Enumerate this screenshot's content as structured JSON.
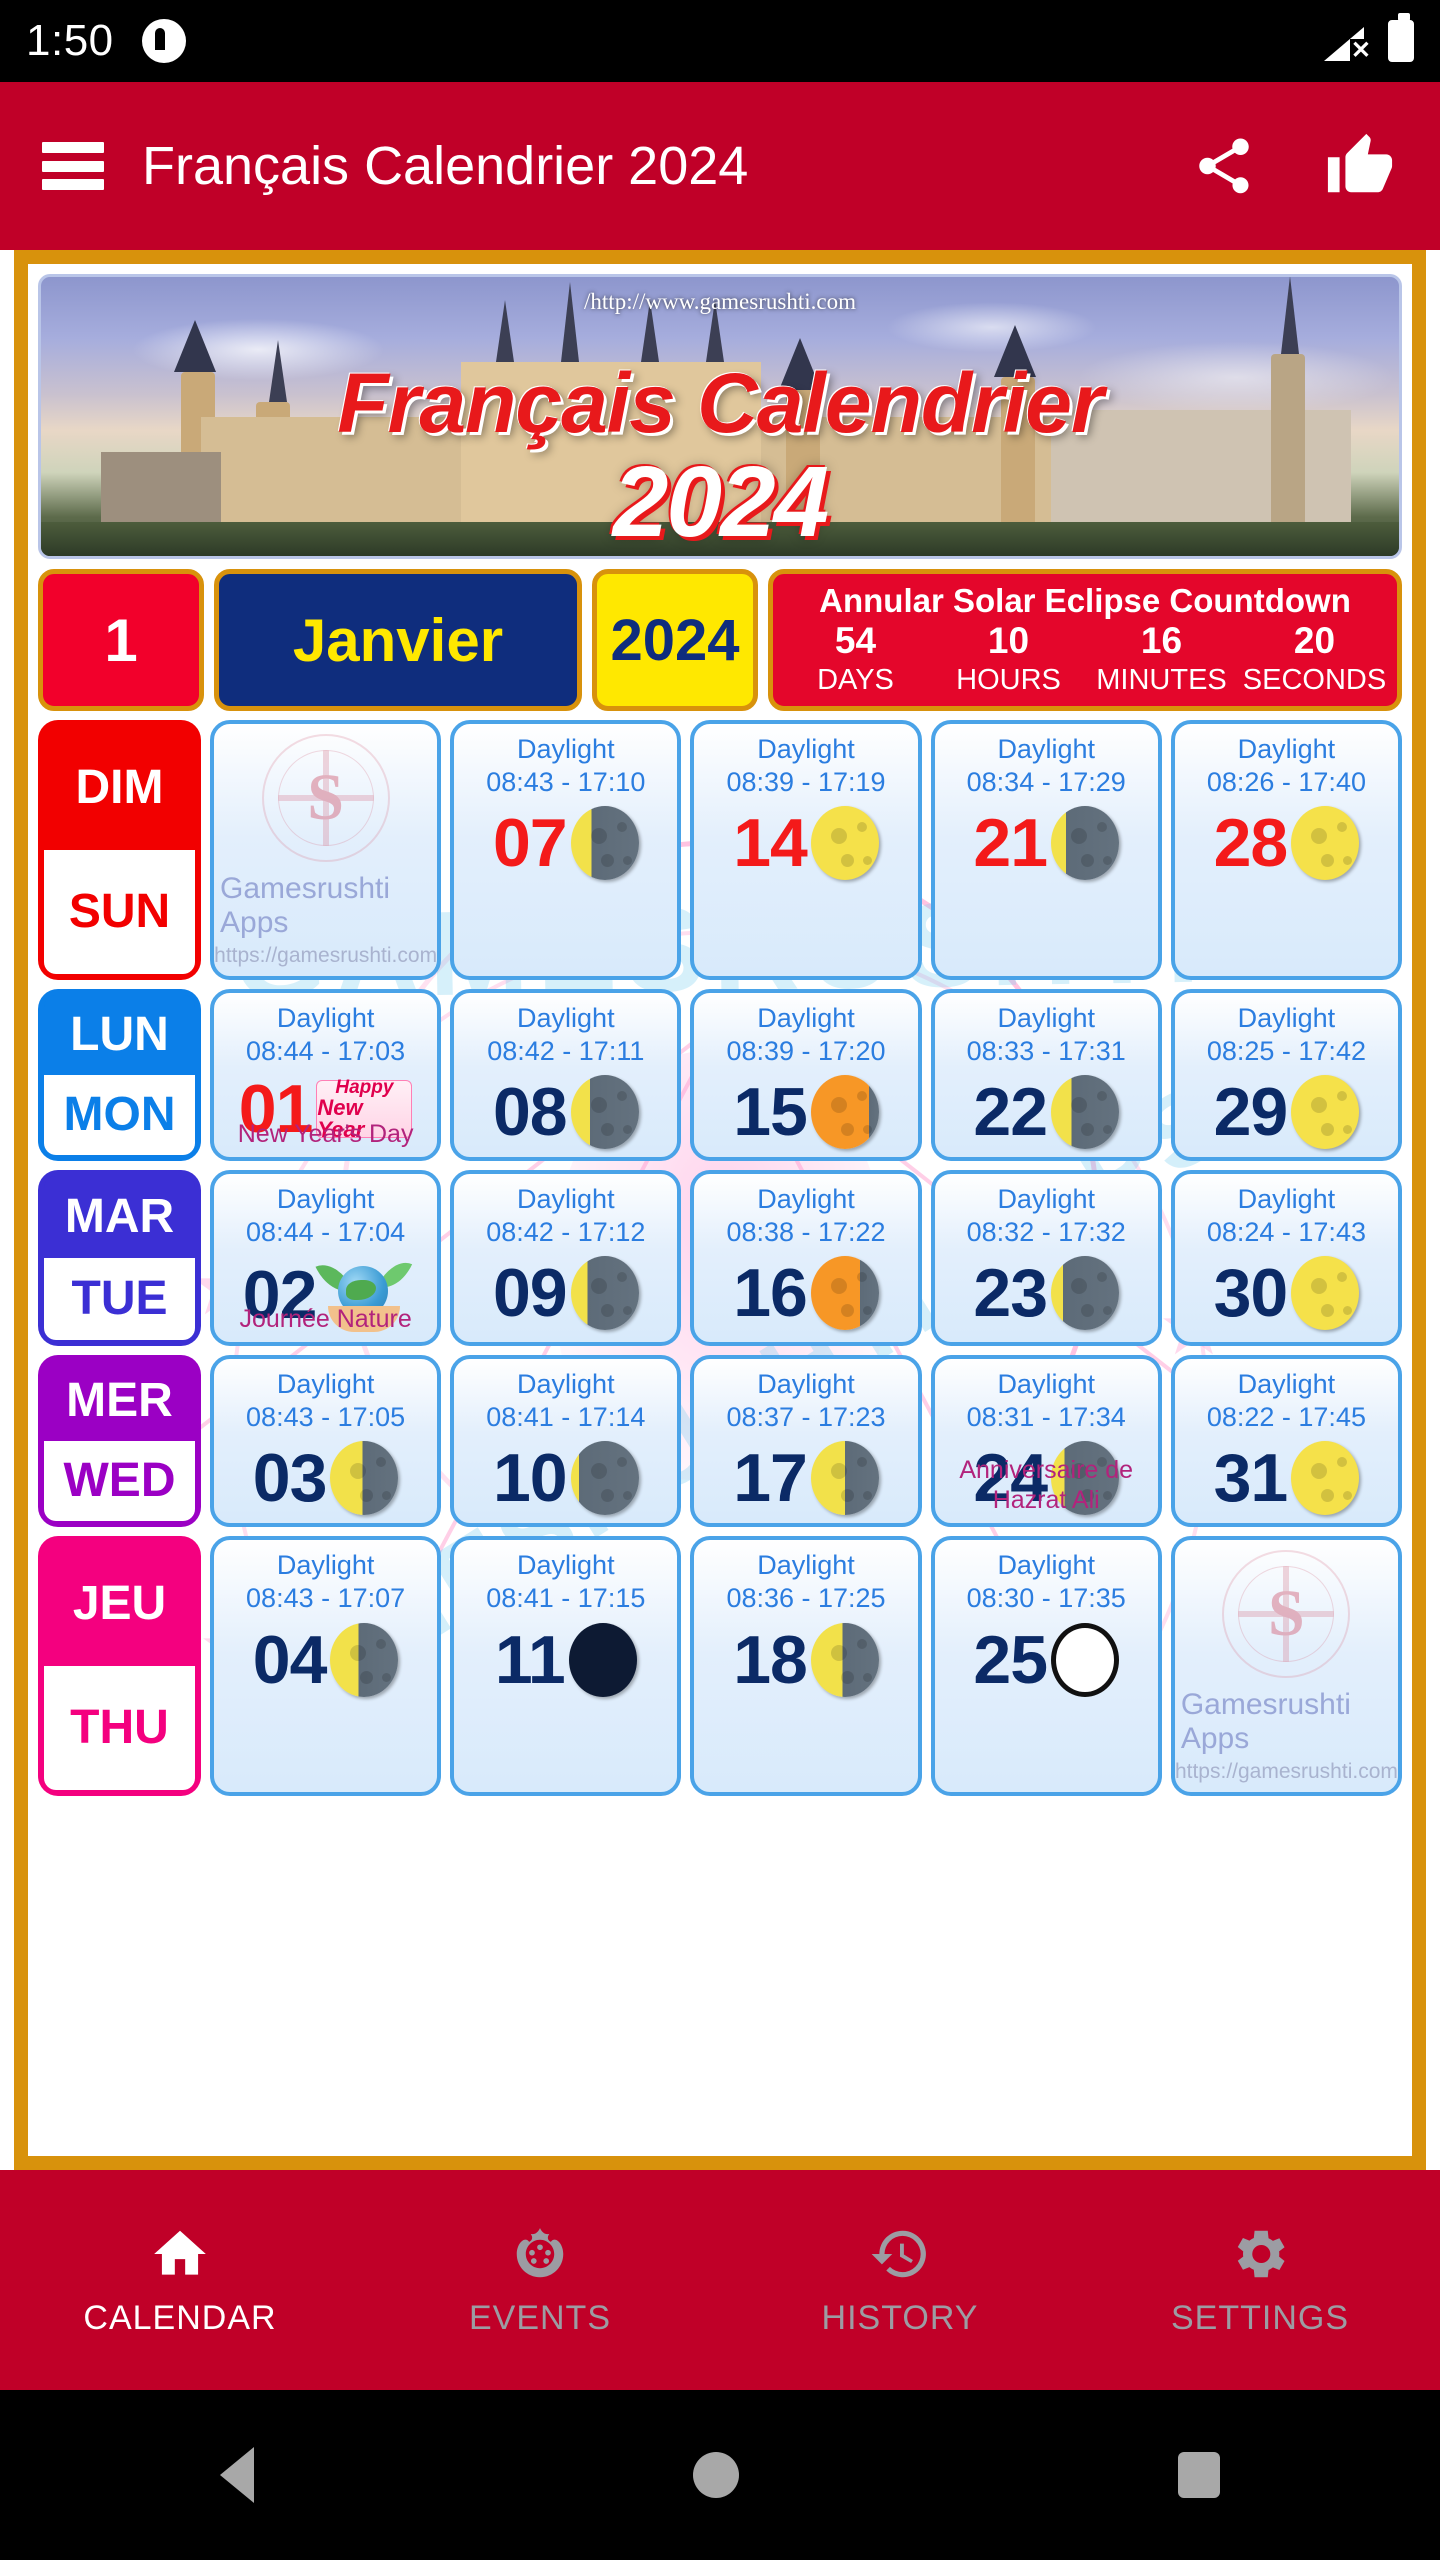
{
  "statusbar": {
    "time": "1:50",
    "signal_icon": "no-signal-icon",
    "battery_icon": "battery-full-icon"
  },
  "appbar": {
    "title": "Français Calendrier 2024",
    "menu_icon": "hamburger-menu-icon",
    "share_icon": "share-icon",
    "like_icon": "thumbs-up-icon"
  },
  "banner": {
    "url": "/http://www.gamesrushti.com",
    "title": "Français Calendrier",
    "year": "2024"
  },
  "selector": {
    "day": "1",
    "month": "Janvier",
    "year": "2024"
  },
  "countdown": {
    "title": "Annular Solar Eclipse Countdown",
    "values": [
      "54",
      "10",
      "16",
      "20"
    ],
    "labels": [
      "DAYS",
      "HOURS",
      "MINUTES",
      "SECONDS"
    ]
  },
  "branding": {
    "name": "Gamesrushti Apps",
    "url": "https://gamesrushti.com",
    "logo_icon": "gamesrushti-logo-icon"
  },
  "watermark": {
    "text1": "GAMESRUSHTI",
    "text2": "GAMESRUSHTI APPS"
  },
  "daylight_label": "Daylight",
  "rows": [
    {
      "abbr": "DIM",
      "en": "SUN",
      "color": "#f20000",
      "text_color": "#f20000",
      "cells": [
        {
          "type": "brand"
        },
        {
          "day": "07",
          "red": true,
          "daylight": "08:43 - 17:10",
          "moon": "waning-gibbous",
          "lit": 0.3,
          "side": "left",
          "tint": "#f2e14a",
          "event": ""
        },
        {
          "day": "14",
          "red": true,
          "daylight": "08:39 - 17:19",
          "moon": "first-quarter-bright",
          "lit": 1.0,
          "side": "left",
          "tint": "#f5e14a",
          "event": ""
        },
        {
          "day": "21",
          "red": true,
          "daylight": "08:34 - 17:29",
          "moon": "waning-crescent",
          "lit": 0.22,
          "side": "left",
          "tint": "#f2e14a",
          "event": ""
        },
        {
          "day": "28",
          "red": true,
          "daylight": "08:26 - 17:40",
          "moon": "full-moon",
          "lit": 1.0,
          "side": "left",
          "tint": "#f5e14a",
          "event": ""
        }
      ]
    },
    {
      "abbr": "LUN",
      "en": "MON",
      "color": "#0b7fe8",
      "text_color": "#0b7fe8",
      "cells": [
        {
          "day": "01",
          "red": true,
          "daylight": "08:44 - 17:03",
          "moon": "new-year-badge",
          "badge": "newyear",
          "event": "New Year's Day"
        },
        {
          "day": "08",
          "red": false,
          "daylight": "08:42 - 17:11",
          "moon": "waning-gibbous",
          "lit": 0.28,
          "side": "left",
          "tint": "#f2e14a",
          "event": ""
        },
        {
          "day": "15",
          "red": false,
          "daylight": "08:39 - 17:20",
          "moon": "waxing-orange",
          "lit": 0.85,
          "side": "left",
          "tint": "#f79726",
          "event": ""
        },
        {
          "day": "22",
          "red": false,
          "daylight": "08:33 - 17:31",
          "moon": "waning-gibbous-green",
          "lit": 0.3,
          "side": "left",
          "tint": "#f2e14a",
          "event": ""
        },
        {
          "day": "29",
          "red": false,
          "daylight": "08:25 - 17:42",
          "moon": "full-moon",
          "lit": 1.0,
          "side": "left",
          "tint": "#f5e14a",
          "event": ""
        }
      ]
    },
    {
      "abbr": "MAR",
      "en": "TUE",
      "color": "#3b2fd4",
      "text_color": "#3b2fd4",
      "cells": [
        {
          "day": "02",
          "red": false,
          "daylight": "08:44 - 17:04",
          "moon": "nature-badge",
          "badge": "nature",
          "event": "Journée Nature"
        },
        {
          "day": "09",
          "red": false,
          "daylight": "08:42 - 17:12",
          "moon": "waning-crescent-red",
          "lit": 0.24,
          "side": "left",
          "tint": "#f2e14a",
          "event": ""
        },
        {
          "day": "16",
          "red": false,
          "daylight": "08:38 - 17:22",
          "moon": "waxing-orange",
          "lit": 0.72,
          "side": "left",
          "tint": "#f79726",
          "event": ""
        },
        {
          "day": "23",
          "red": false,
          "daylight": "08:32 - 17:32",
          "moon": "waning-crescent",
          "lit": 0.18,
          "side": "left",
          "tint": "#f2e14a",
          "event": ""
        },
        {
          "day": "30",
          "red": false,
          "daylight": "08:24 - 17:43",
          "moon": "full-moon",
          "lit": 1.0,
          "side": "left",
          "tint": "#f5e14a",
          "event": ""
        }
      ]
    },
    {
      "abbr": "MER",
      "en": "WED",
      "color": "#9b00c4",
      "text_color": "#9b00c4",
      "cells": [
        {
          "day": "03",
          "red": false,
          "daylight": "08:43 - 17:05",
          "moon": "last-quarter",
          "lit": 0.48,
          "side": "left",
          "tint": "#f2e14a",
          "event": ""
        },
        {
          "day": "10",
          "red": false,
          "daylight": "08:41 - 17:14",
          "moon": "waning-crescent",
          "lit": 0.12,
          "side": "left",
          "tint": "#f2e14a",
          "event": ""
        },
        {
          "day": "17",
          "red": false,
          "daylight": "08:37 - 17:23",
          "moon": "first-quarter",
          "lit": 0.5,
          "side": "left",
          "tint": "#f2e14a",
          "event": ""
        },
        {
          "day": "24",
          "red": false,
          "daylight": "08:31 - 17:34",
          "moon": "waning-gibbous-green",
          "lit": 0.2,
          "side": "left",
          "tint": "#f2e14a",
          "event": "Anniversaire de Hazrat Ali"
        },
        {
          "day": "31",
          "red": false,
          "daylight": "08:22 - 17:45",
          "moon": "full-moon",
          "lit": 1.0,
          "side": "left",
          "tint": "#f5e14a",
          "event": ""
        }
      ]
    },
    {
      "abbr": "JEU",
      "en": "THU",
      "color": "#f4007f",
      "text_color": "#f4007f",
      "cells": [
        {
          "day": "04",
          "red": false,
          "daylight": "08:43 - 17:07",
          "moon": "last-quarter",
          "lit": 0.42,
          "side": "left",
          "tint": "#f2e14a",
          "event": ""
        },
        {
          "day": "11",
          "red": false,
          "daylight": "08:41 - 17:15",
          "moon": "new-moon",
          "lit": 0.0,
          "side": "left",
          "tint": "#0d1a33",
          "event": ""
        },
        {
          "day": "18",
          "red": false,
          "daylight": "08:36 - 17:25",
          "moon": "first-quarter",
          "lit": 0.46,
          "side": "left",
          "tint": "#f2e14a",
          "event": ""
        },
        {
          "day": "25",
          "red": false,
          "daylight": "08:30 - 17:35",
          "moon": "full-moon-white",
          "lit": 1.0,
          "side": "left",
          "tint": "#ffffff",
          "event": ""
        },
        {
          "type": "brand"
        }
      ]
    }
  ],
  "bottomnav": {
    "items": [
      {
        "label": "CALENDAR",
        "icon": "home-icon",
        "active": true
      },
      {
        "label": "EVENTS",
        "icon": "events-wreath-icon",
        "active": false
      },
      {
        "label": "HISTORY",
        "icon": "history-clock-icon",
        "active": false
      },
      {
        "label": "SETTINGS",
        "icon": "gear-icon",
        "active": false
      }
    ]
  },
  "sysnav": {
    "back": "back-triangle-icon",
    "home": "home-circle-icon",
    "recents": "recents-square-icon"
  },
  "newyear_badge": {
    "l1": "Happy",
    "l2": "New Year"
  }
}
